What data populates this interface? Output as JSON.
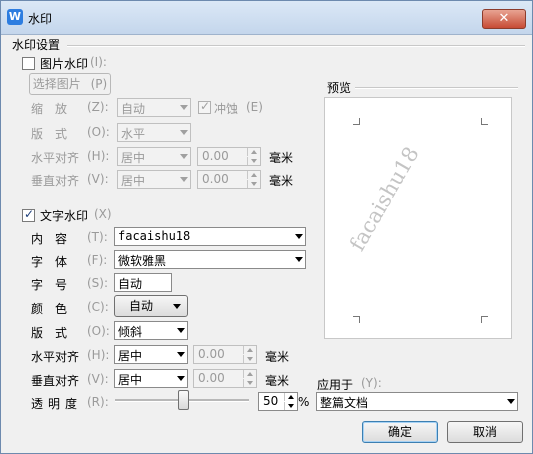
{
  "window": {
    "title": "水印",
    "close": "✕",
    "app_icon": "W"
  },
  "section": {
    "label": "水印设置"
  },
  "image_wm": {
    "checkbox_label": "图片水印",
    "checkbox_key": "(I):",
    "select_btn": "选择图片",
    "select_btn_key": "(P)",
    "scale_label": "缩　放",
    "scale_key": "(Z):",
    "scale_value": "自动",
    "washout_label": "冲蚀",
    "washout_key": "(E)",
    "layout_label": "版　式",
    "layout_key": "(O):",
    "layout_value": "水平",
    "halign_label": "水平对齐",
    "halign_key": "(H):",
    "halign_value": "居中",
    "halign_num": "0.00",
    "valign_label": "垂直对齐",
    "valign_key": "(V):",
    "valign_value": "居中",
    "valign_num": "0.00",
    "unit": "毫米"
  },
  "text_wm": {
    "checkbox_label": "文字水印",
    "checkbox_key": "(X)",
    "content_label": "内　容",
    "content_key": "(T):",
    "content_value": "facaishu18",
    "font_label": "字　体",
    "font_key": "(F):",
    "font_value": "微软雅黑",
    "size_label": "字　号",
    "size_key": "(S):",
    "size_value": "自动",
    "color_label": "颜　色",
    "color_key": "(C):",
    "color_value": "自动",
    "layout_label": "版　式",
    "layout_key": "(O):",
    "layout_value": "倾斜",
    "halign_label": "水平对齐",
    "halign_key": "(H):",
    "halign_value": "居中",
    "halign_num": "0.00",
    "valign_label": "垂直对齐",
    "valign_key": "(V):",
    "valign_value": "居中",
    "valign_num": "0.00",
    "unit": "毫米",
    "transparency_label": "透明度",
    "transparency_key": "(R):",
    "transparency_value": "50",
    "transparency_level_pct": 50,
    "percent": "%"
  },
  "preview": {
    "label": "预览",
    "watermark": "facaishu18"
  },
  "apply": {
    "label": "应用于",
    "key": "(Y):",
    "value": "整篇文档"
  },
  "buttons": {
    "ok": "确定",
    "cancel": "取消"
  },
  "colors": {
    "titlebar": "#c4d6ec",
    "dialog_bg": "#f0f0f0",
    "disabled_text": "#9a9a9a"
  }
}
